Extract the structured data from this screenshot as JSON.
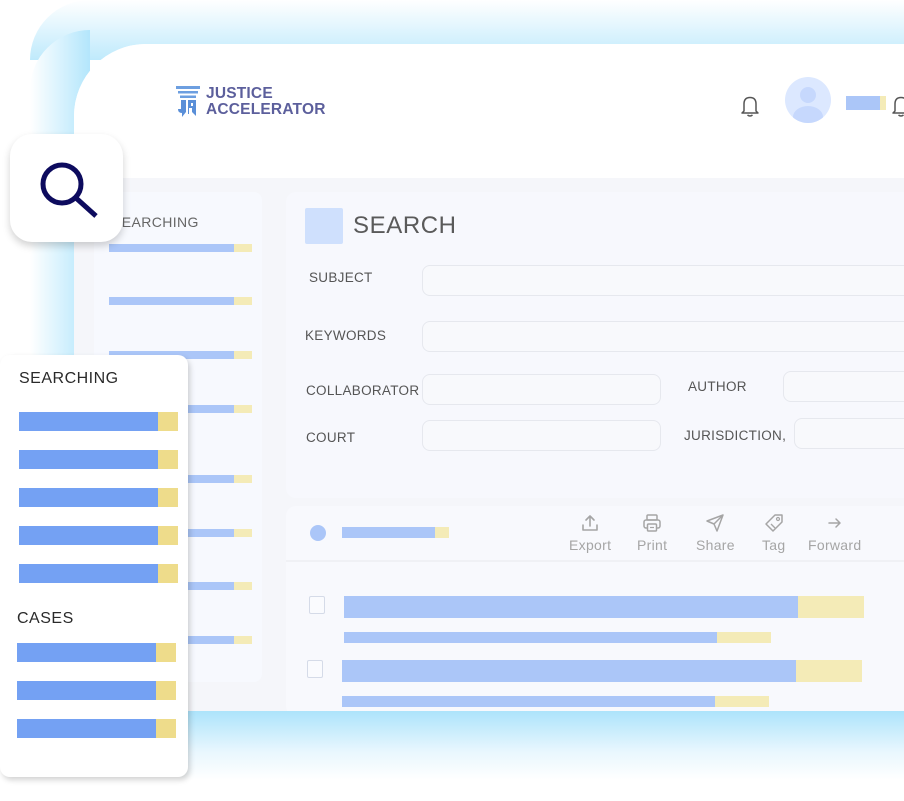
{
  "brand": {
    "name_line1": "JUSTICE",
    "name_line2": "ACCELERATOR",
    "logo_icon": "justice-pillar-logo",
    "color": "#5c5f9c"
  },
  "header": {
    "notification_icon": "bell-icon",
    "avatar_icon": "user-avatar-icon",
    "secondary_icon": "bell-icon"
  },
  "colors": {
    "placeholder_blue": "#abc6f8",
    "placeholder_yellow": "#f4ebb7",
    "card_blue": "#74a1f3",
    "card_yellow": "#eedc8b",
    "glow": "#b3e6fc",
    "search_icon": "#0d0b5e"
  },
  "sidebar": {
    "title": "SEARCHING"
  },
  "search_panel": {
    "title": "SEARCH",
    "fields": {
      "subject": {
        "label": "SUBJECT",
        "value": ""
      },
      "keywords": {
        "label": "KEYWORDS",
        "value": ""
      },
      "collaborator": {
        "label": "COLLABORATOR",
        "value": ""
      },
      "author": {
        "label": "AUTHOR",
        "value": ""
      },
      "court": {
        "label": "COURT",
        "value": ""
      },
      "jurisdiction": {
        "label": "JURISDICTION,",
        "value": ""
      }
    }
  },
  "results": {
    "actions": [
      {
        "label": "Export",
        "icon": "upload-icon"
      },
      {
        "label": "Print",
        "icon": "printer-icon"
      },
      {
        "label": "Share",
        "icon": "send-icon"
      },
      {
        "label": "Tag",
        "icon": "tag-icon"
      },
      {
        "label": "Forward",
        "icon": "arrow-right-icon"
      }
    ]
  },
  "floating_badge": {
    "icon": "magnifier-icon"
  },
  "floating_card": {
    "searching_title": "SEARCHING",
    "cases_title": "CASES"
  }
}
